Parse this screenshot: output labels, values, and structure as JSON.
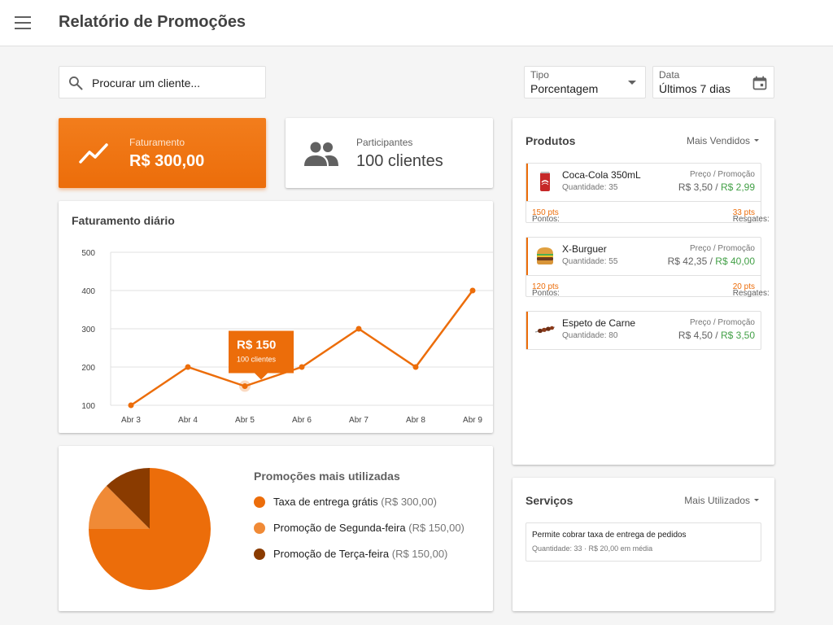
{
  "app": {
    "title": "Relatório de Promoções"
  },
  "search": {
    "placeholder": "Procurar um cliente..."
  },
  "filters": {
    "tipo": {
      "label": "Tipo",
      "value": "Porcentagem"
    },
    "data": {
      "label": "Data",
      "value": "Últimos 7 dias"
    }
  },
  "kpis": {
    "revenue": {
      "label": "Faturamento",
      "value": "R$ 300,00"
    },
    "participants": {
      "label": "Participantes",
      "value": "100 clientes"
    }
  },
  "daily_chart": {
    "title": "Faturamento diário",
    "tooltip": {
      "value": "R$ 150",
      "sub": "100 clientes"
    }
  },
  "chart_data": {
    "type": "line",
    "title": "Faturamento diário",
    "categories": [
      "Abr 3",
      "Abr 4",
      "Abr 5",
      "Abr 6",
      "Abr 7",
      "Abr 8",
      "Abr 9"
    ],
    "values": [
      100,
      200,
      150,
      200,
      300,
      200,
      400
    ],
    "y_ticks": [
      100,
      200,
      300,
      400,
      500
    ],
    "ylim": [
      100,
      500
    ],
    "grid": true,
    "color": "#ec6d0a",
    "highlight_index": 2
  },
  "promotions": {
    "title": "Promoções mais utilizadas",
    "items": [
      {
        "name": "Taxa de entrega grátis",
        "amount": "(R$ 300,00)",
        "share": 0.75,
        "color": "#ec6d0a"
      },
      {
        "name": "Promoção de Segunda-feira",
        "amount": "(R$ 150,00)",
        "share": 0.125,
        "color": "#f08a36"
      },
      {
        "name": "Promoção de Terça-feira",
        "amount": "(R$ 150,00)",
        "share": 0.125,
        "color": "#8a3b00"
      }
    ]
  },
  "products": {
    "title": "Produtos",
    "sort": "Mais Vendidos",
    "items": [
      {
        "name": "Coca-Cola 350mL",
        "qty": "Quantidade: 35",
        "price_label": "Preço / Promoção",
        "price": "R$ 3,50",
        "sep": " / ",
        "promo": "R$ 2,99",
        "points_label": "Pontos: ",
        "points": "150 pts",
        "redeem_label": "Resgates: ",
        "redeem": "33 pts",
        "icon": "soda-can-icon"
      },
      {
        "name": "X-Burguer",
        "qty": "Quantidade: 55",
        "price_label": "Preço / Promoção",
        "price": "R$ 42,35",
        "sep": " / ",
        "promo": "R$ 40,00",
        "points_label": "Pontos: ",
        "points": "120 pts",
        "redeem_label": "Resgates: ",
        "redeem": "20 pts",
        "icon": "burger-icon"
      },
      {
        "name": "Espeto de Carne",
        "qty": "Quantidade: 80",
        "price_label": "Preço / Promoção",
        "price": "R$ 4,50",
        "sep": " / ",
        "promo": "R$ 3,50",
        "icon": "skewer-icon"
      }
    ]
  },
  "services": {
    "title": "Serviços",
    "sort": "Mais Utilizados",
    "items": [
      {
        "desc": "Permite cobrar taxa de entrega de pedidos",
        "meta": "Quantidade: 33 · R$ 20,00 em média"
      }
    ]
  },
  "colors": {
    "accent": "#ec6d0a",
    "promo_green": "#43a047"
  }
}
